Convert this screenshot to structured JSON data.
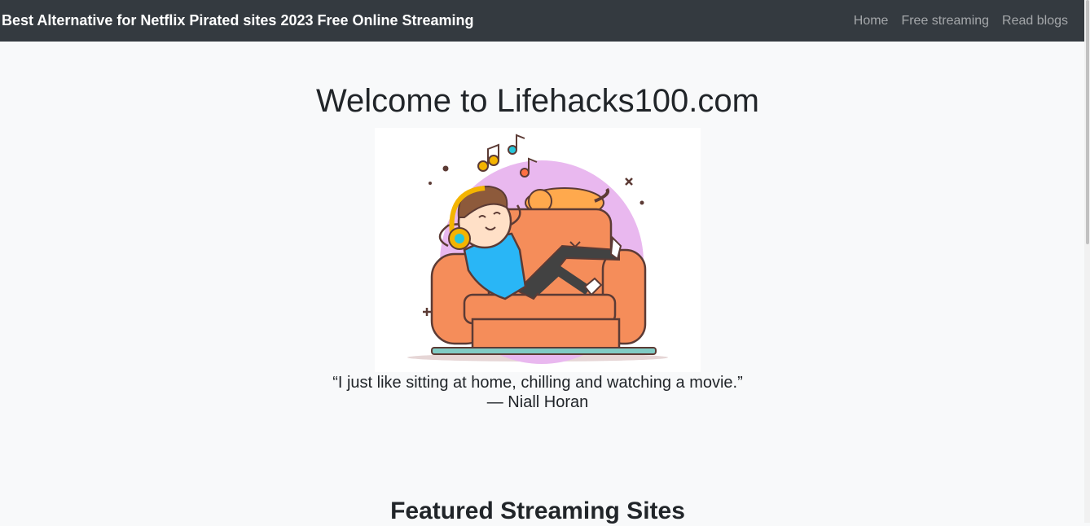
{
  "navbar": {
    "brand": "Best Alternative for Netflix Pirated sites 2023 Free Online Streaming",
    "links": [
      "Home",
      "Free streaming",
      "Read blogs"
    ]
  },
  "hero": {
    "title": "Welcome to Lifehacks100.com",
    "quote": "“I just like sitting at home, chilling and watching a movie.”",
    "author": "— Niall Horan"
  },
  "featured": {
    "title": "Featured Streaming Sites"
  },
  "colors": {
    "navbar_bg": "#343a40",
    "page_bg": "#f8f9fa",
    "text": "#212529"
  }
}
